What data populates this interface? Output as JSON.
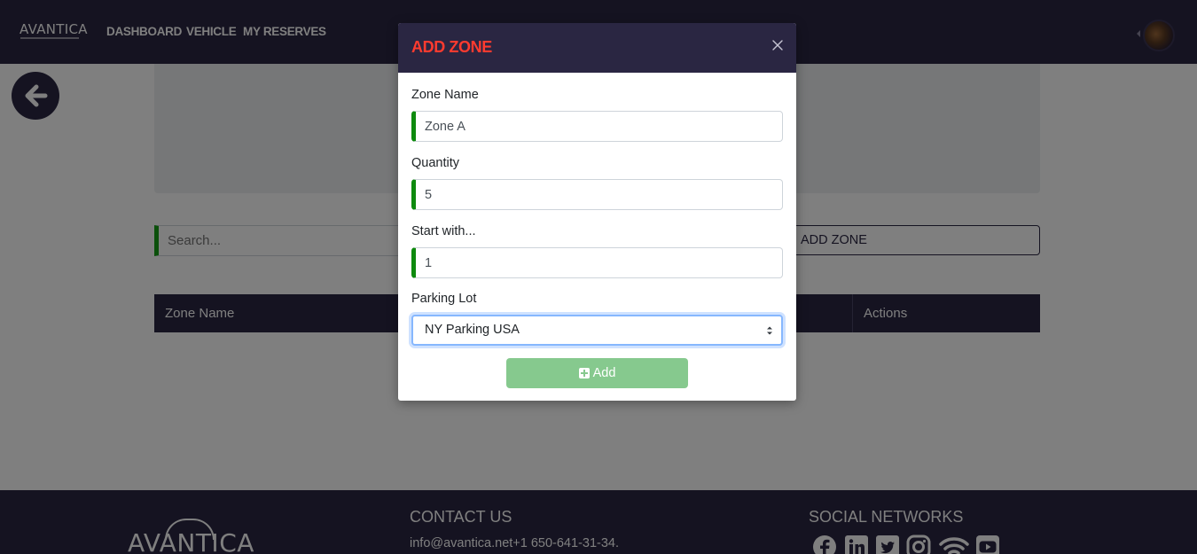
{
  "navbar": {
    "logo": "AVANTICA",
    "items": [
      {
        "label": "DASHBOARD"
      },
      {
        "label": "VEHICLE"
      },
      {
        "label": "MY RESERVES"
      }
    ]
  },
  "page": {
    "search_placeholder": "Search...",
    "add_zone_label": "ADD ZONE",
    "table_headers": [
      "Zone Name",
      "Actions"
    ]
  },
  "footer": {
    "logo": "AVANTICA",
    "contact_heading": "CONTACT US",
    "contact_text": "info@avantica.net+1 650-641-31-34.",
    "social_heading": "SOCIAL NETWORKS",
    "social_icons": [
      "facebook-icon",
      "linkedin-icon",
      "twitter-icon",
      "instagram-icon",
      "wifi-icon",
      "youtube-icon"
    ]
  },
  "modal": {
    "title": "ADD ZONE",
    "fields": [
      {
        "label": "Zone Name",
        "value": "Zone A"
      },
      {
        "label": "Quantity",
        "value": "5"
      },
      {
        "label": "Start with...",
        "value": "1"
      }
    ],
    "parking_lot": {
      "label": "Parking Lot",
      "selected": "NY Parking USA"
    },
    "submit_label": "Add"
  },
  "colors": {
    "nav_bg": "#2a2642",
    "title_red": "#ff3b2f",
    "field_accent": "#0e8a0e",
    "add_button": "#86c98e"
  }
}
